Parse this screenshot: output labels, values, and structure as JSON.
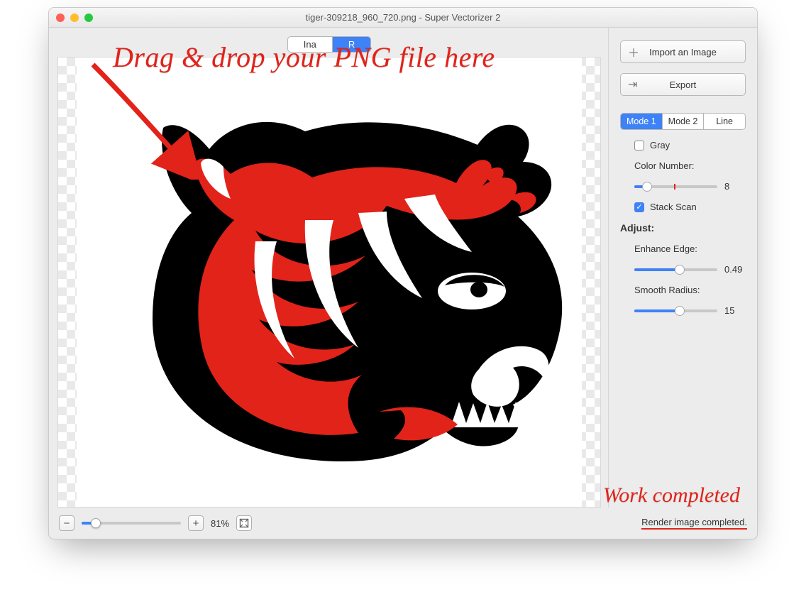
{
  "window_title": "tiger-309218_960_720.png - Super Vectorizer 2",
  "top_segments": {
    "left": "Ina",
    "right": "R"
  },
  "buttons": {
    "import": "Import an Image",
    "export": "Export"
  },
  "modes": {
    "m1": "Mode 1",
    "m2": "Mode 2",
    "line": "Line"
  },
  "gray_label": "Gray",
  "color_number": {
    "label": "Color Number:",
    "value": "8",
    "thumb_pct": 15,
    "mark_pct": 48
  },
  "stack_scan_label": "Stack Scan",
  "adjust_label": "Adjust:",
  "enhance": {
    "label": "Enhance Edge:",
    "value": "0.49",
    "pct": 55
  },
  "smooth": {
    "label": "Smooth Radius:",
    "value": "15",
    "pct": 55
  },
  "zoom": {
    "value": "81%",
    "pct": 14
  },
  "status_text": "Render image completed.",
  "overlay": {
    "drag": "Drag & drop your PNG file here",
    "work": "Work completed"
  }
}
